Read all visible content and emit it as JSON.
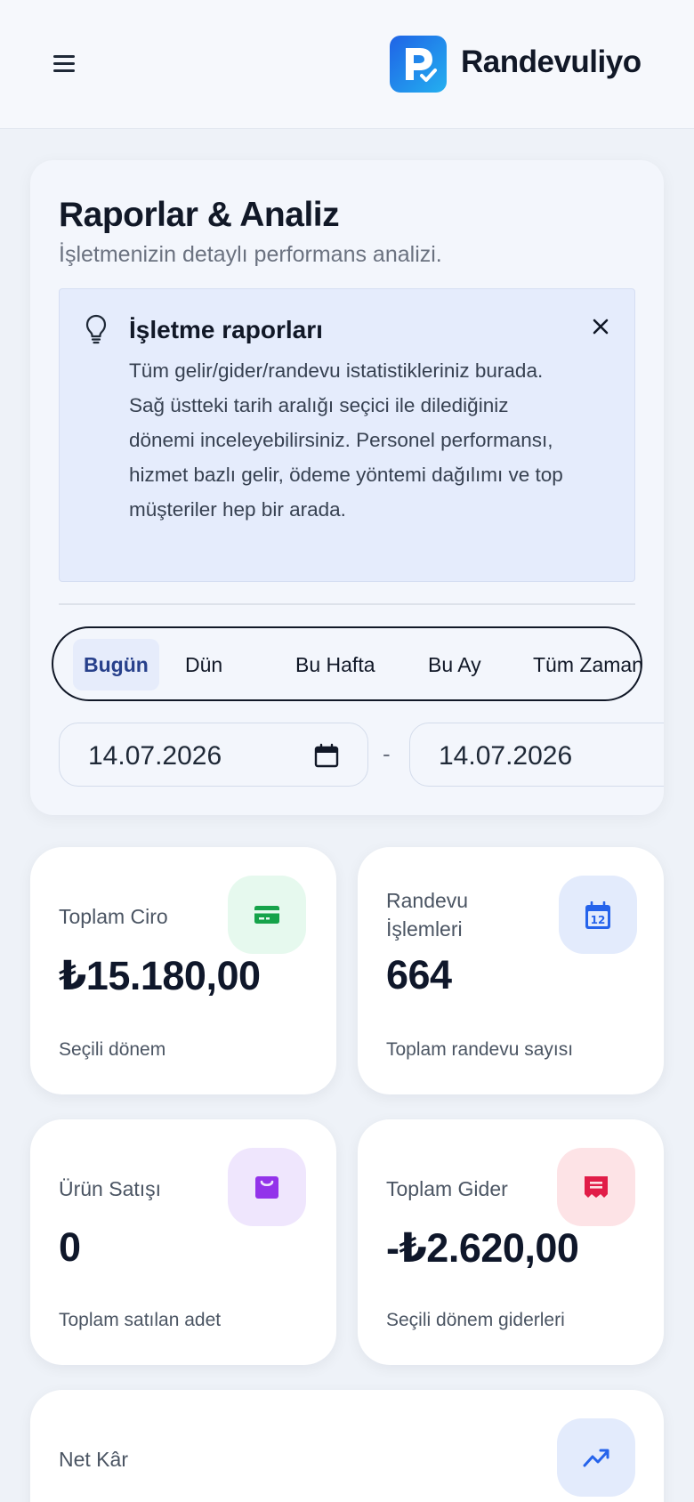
{
  "header": {
    "brand_name": "Randevuliyo",
    "brand_color": "#1f63e6"
  },
  "page": {
    "title": "Raporlar & Analiz",
    "subtitle": "İşletmenizin detaylı performans analizi."
  },
  "info_box": {
    "title": "İşletme raporları",
    "text": "Tüm gelir/gider/randevu istatistikleriniz burada. Sağ üstteki tarih aralığı seçici ile dilediğiniz dönemi inceleyebilirsiniz. Personel performansı, hizmet bazlı gelir, ödeme yöntemi dağılımı ve top müşteriler hep bir arada."
  },
  "presets": {
    "items": [
      "Bugün",
      "Dün",
      "Bu Hafta",
      "Bu Ay",
      "Tüm Zaman"
    ],
    "active": "Bugün"
  },
  "date_range": {
    "start": "14.07.2026",
    "separator": "-",
    "end": "14.07.2026"
  },
  "stats": [
    {
      "label": "Toplam Ciro",
      "value": "₺15.180,00",
      "note": "Seçili dönem",
      "icon": "credit-card-icon",
      "icon_color": "#16a34a",
      "icon_bg": "#e6f9ee"
    },
    {
      "label": "Randevu İşlemleri",
      "value": "664",
      "note": "Toplam randevu sayısı",
      "icon": "calendar-icon",
      "icon_color": "#2563eb",
      "icon_bg": "#e3ebfc",
      "icon_text": "12"
    },
    {
      "label": "Ürün Satışı",
      "value": "0",
      "note": "Toplam satılan adet",
      "icon": "shopping-bag-icon",
      "icon_color": "#9333ea",
      "icon_bg": "#efe6fd"
    },
    {
      "label": "Toplam Gider",
      "value": "-₺2.620,00",
      "note": "Seçili dönem giderleri",
      "icon": "receipt-icon",
      "icon_color": "#e11d48",
      "icon_bg": "#fde3e6"
    },
    {
      "label": "Net Kâr",
      "icon": "trending-up-icon",
      "icon_color": "#2563eb",
      "icon_bg": "#e3ebfc"
    }
  ]
}
